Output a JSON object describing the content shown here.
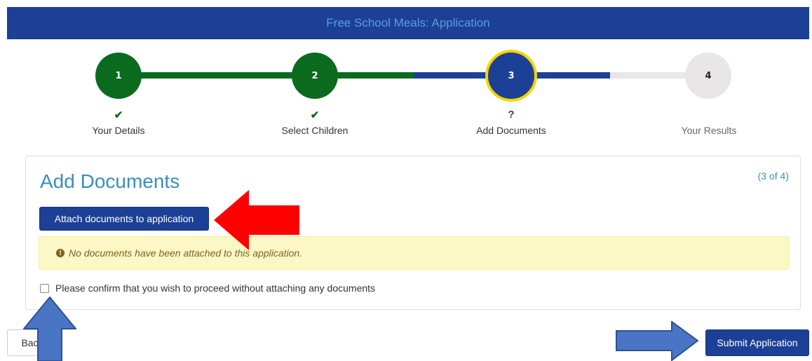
{
  "header": {
    "title": "Free School Meals: Application"
  },
  "colors": {
    "brand_blue": "#1b4096",
    "completed_green": "#0a6b1f",
    "current_ring": "#f5d400",
    "pending_grey": "#e8e6e6",
    "annotation_red": "#ff0000",
    "annotation_blue": "#4a75c4"
  },
  "steps": [
    {
      "number": "1",
      "status": "✔",
      "label": "Your Details",
      "state": "completed"
    },
    {
      "number": "2",
      "status": "✔",
      "label": "Select Children",
      "state": "completed"
    },
    {
      "number": "3",
      "status": "?",
      "label": "Add Documents",
      "state": "current"
    },
    {
      "number": "4",
      "status": "",
      "label": "Your Results",
      "state": "pending"
    }
  ],
  "panel": {
    "title": "Add Documents",
    "step_count": "(3 of 4)",
    "attach_button": "Attach documents to application",
    "warning_icon": "!",
    "warning_text": "No documents have been attached to this application.",
    "confirm_text": "Please confirm that you wish to proceed without attaching any documents",
    "confirm_checked": false
  },
  "footer": {
    "back_button": "Back",
    "submit_button": "Submit Application"
  },
  "annotations": [
    "red-arrow-left",
    "blue-arrow-up",
    "blue-arrow-right"
  ]
}
